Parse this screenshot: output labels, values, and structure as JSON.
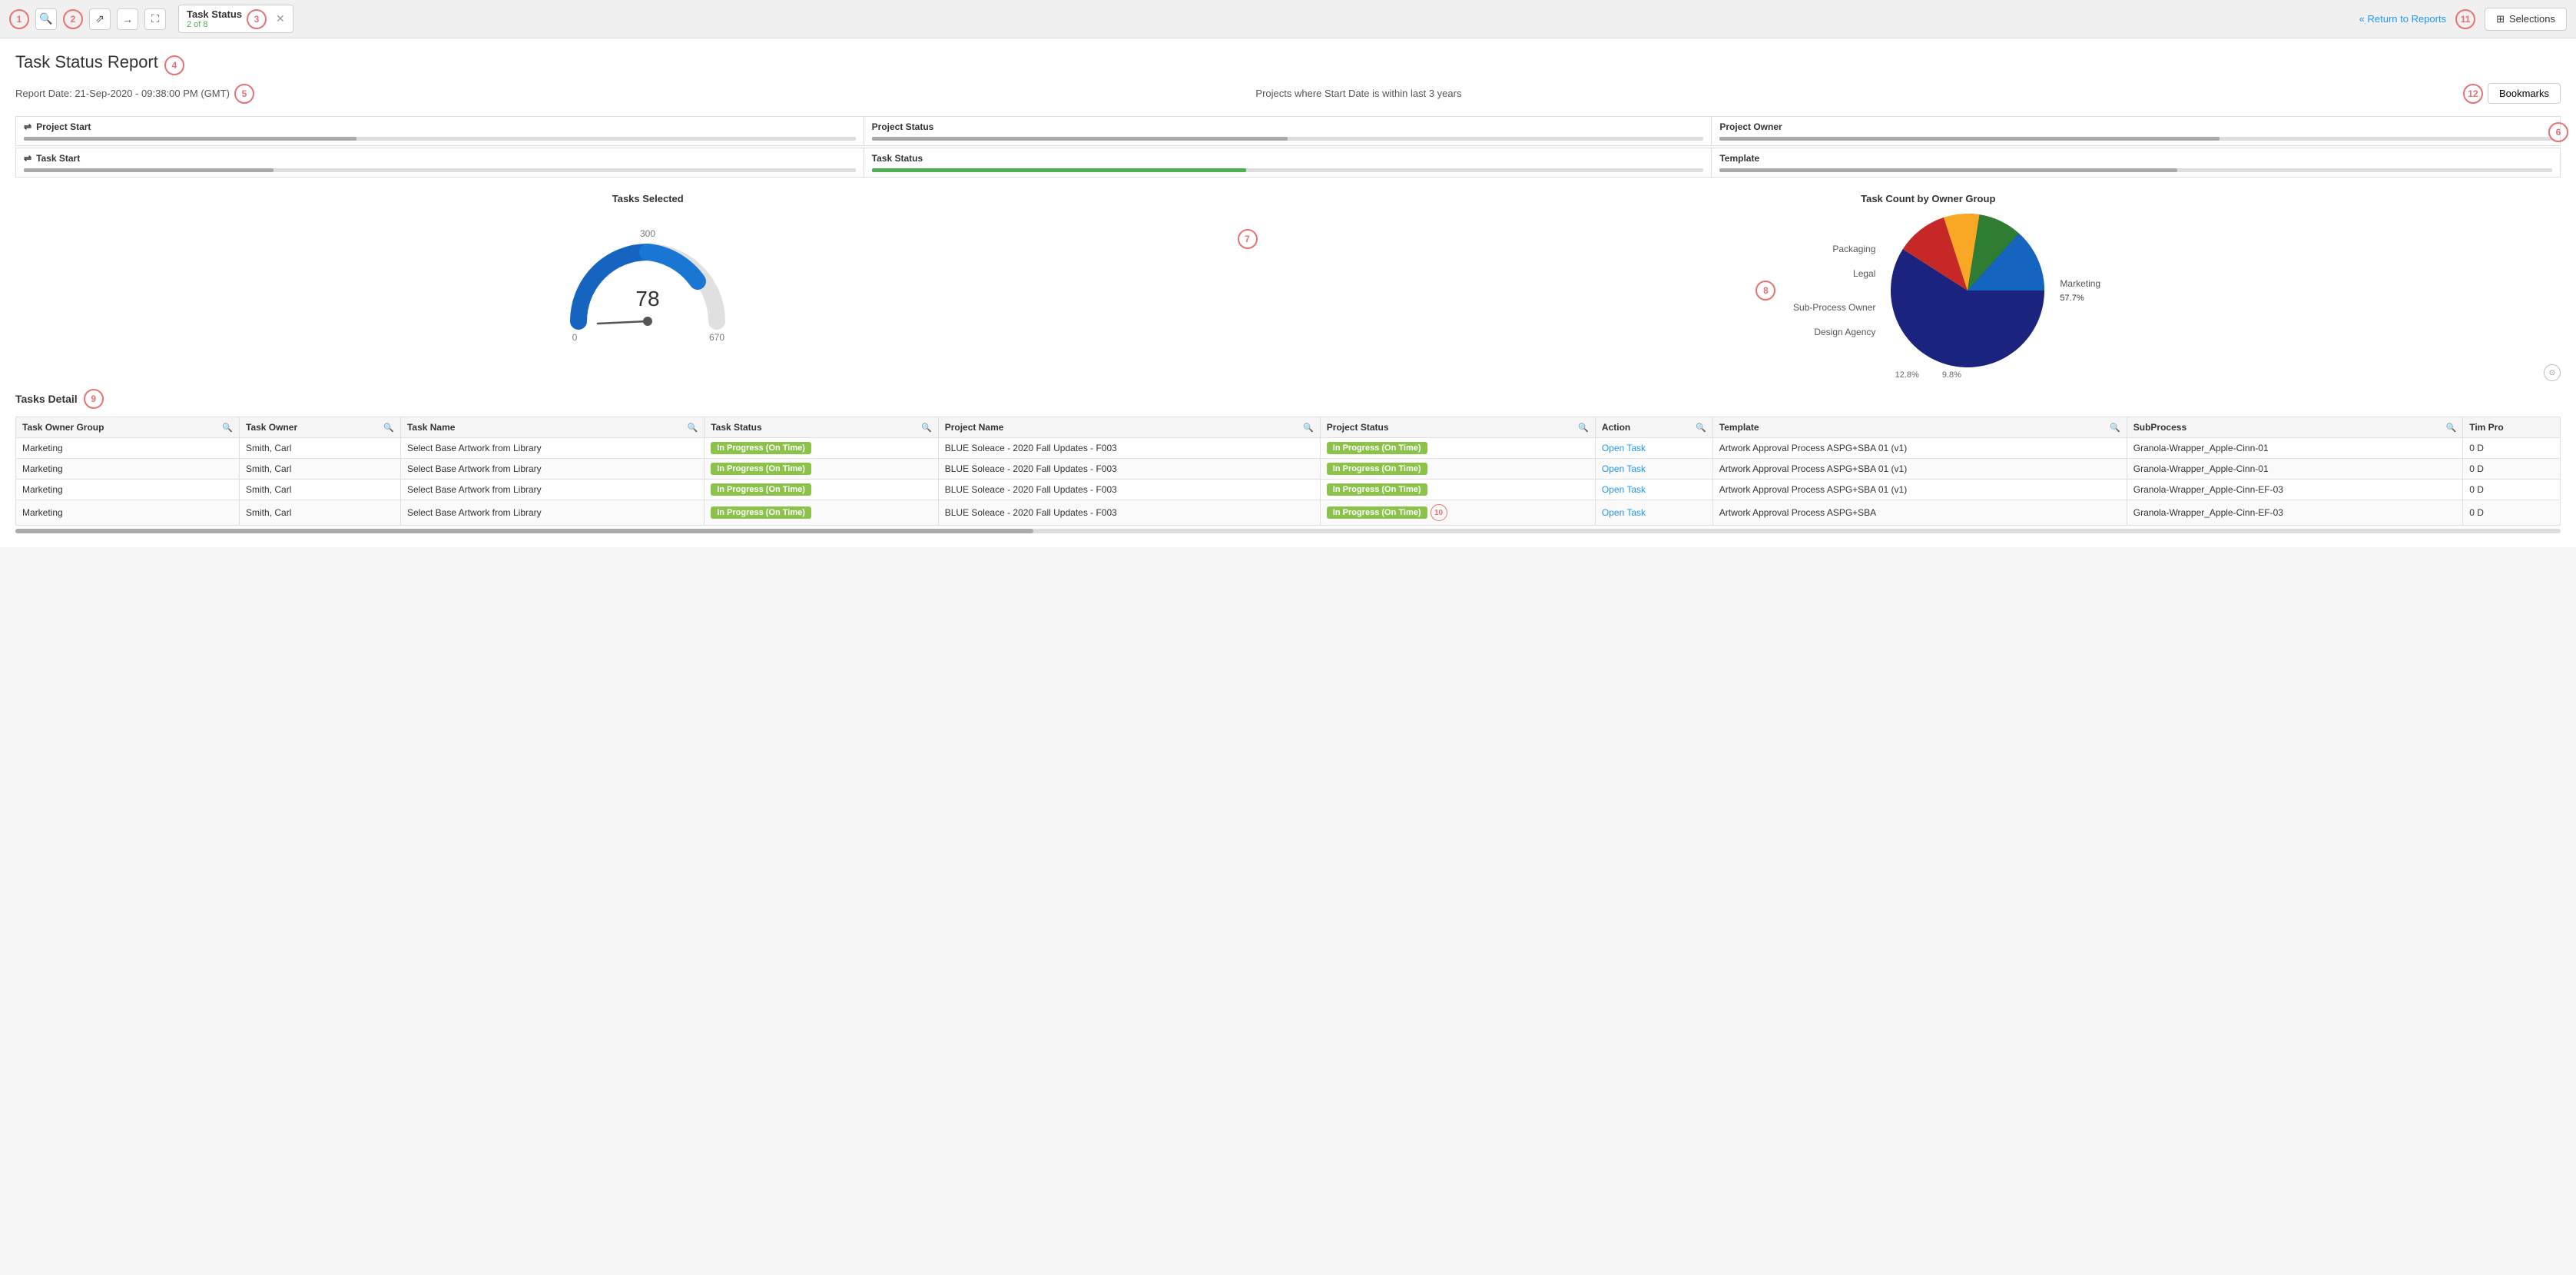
{
  "toolbar": {
    "tab_title": "Task Status",
    "tab_subtitle": "2 of 8",
    "return_link": "« Return to Reports",
    "selections_label": "Selections"
  },
  "report": {
    "title": "Task Status Report",
    "date": "Report Date: 21-Sep-2020 - 09:38:00 PM (GMT)",
    "filter_desc": "Projects where Start Date is within last 3 years",
    "bookmarks_label": "Bookmarks"
  },
  "filters": {
    "row1": [
      {
        "label": "Project Start",
        "bar_width": "40%",
        "bar_color": "gray"
      },
      {
        "label": "Project Status",
        "bar_width": "50%",
        "bar_color": "gray"
      },
      {
        "label": "Project Owner",
        "bar_width": "60%",
        "bar_color": "gray"
      }
    ],
    "row2": [
      {
        "label": "Task Start",
        "bar_width": "30%",
        "bar_color": "gray"
      },
      {
        "label": "Task Status",
        "bar_width": "45%",
        "bar_color": "green"
      },
      {
        "label": "Template",
        "bar_width": "55%",
        "bar_color": "gray"
      }
    ]
  },
  "gauge": {
    "title": "Tasks Selected",
    "value": "78",
    "min": "0",
    "max": "300",
    "right_label": "670"
  },
  "pie": {
    "title": "Task Count by Owner Group",
    "segments": [
      {
        "label": "Marketing",
        "value": 57.7,
        "color": "#1a237e",
        "text_color": "#fff"
      },
      {
        "label": "Design Agency",
        "value": 12.8,
        "color": "#1565c0",
        "text_color": "#fff",
        "pct": "12.8%"
      },
      {
        "label": "Sub-Process Owner",
        "value": 9.8,
        "color": "#2e7d32",
        "text_color": "#fff",
        "pct": "9.8%"
      },
      {
        "label": "Legal",
        "value": 8.0,
        "color": "#f9a825",
        "text_color": "#333"
      },
      {
        "label": "Packaging",
        "value": 11.7,
        "color": "#c62828",
        "text_color": "#fff"
      }
    ],
    "legend": [
      {
        "label": "Packaging",
        "color": "#c62828"
      },
      {
        "label": "Legal",
        "color": "#f9a825"
      },
      {
        "label": "Sub-Process Owner",
        "color": "#2e7d32"
      },
      {
        "label": "Design Agency",
        "color": "#1565c0"
      },
      {
        "label": "Marketing",
        "color": "#1a237e"
      }
    ]
  },
  "tasks_detail": {
    "title": "Tasks Detail",
    "columns": [
      "Task Owner Group",
      "Task Owner",
      "Task Name",
      "Task Status",
      "Project Name",
      "Project Status",
      "Action",
      "Template",
      "SubProcess",
      "Tim Pro"
    ],
    "rows": [
      {
        "task_owner_group": "Marketing",
        "task_owner": "Smith, Carl",
        "task_name": "Select Base Artwork from Library",
        "task_status": "In Progress (On Time)",
        "project_name": "BLUE Soleace - 2020 Fall Updates - F003",
        "project_status": "In Progress (On Time)",
        "action": "Open Task",
        "template": "Artwork Approval Process ASPG+SBA 01 (v1)",
        "subprocess": "Granola-Wrapper_Apple-Cinn-01",
        "time_pro": "0 D"
      },
      {
        "task_owner_group": "Marketing",
        "task_owner": "Smith, Carl",
        "task_name": "Select Base Artwork from Library",
        "task_status": "In Progress (On Time)",
        "project_name": "BLUE Soleace - 2020 Fall Updates - F003",
        "project_status": "In Progress (On Time)",
        "action": "Open Task",
        "template": "Artwork Approval Process ASPG+SBA 01 (v1)",
        "subprocess": "Granola-Wrapper_Apple-Cinn-01",
        "time_pro": "0 D"
      },
      {
        "task_owner_group": "Marketing",
        "task_owner": "Smith, Carl",
        "task_name": "Select Base Artwork from Library",
        "task_status": "In Progress (On Time)",
        "project_name": "BLUE Soleace - 2020 Fall Updates - F003",
        "project_status": "In Progress (On Time)",
        "action": "Open Task",
        "template": "Artwork Approval Process ASPG+SBA 01 (v1)",
        "subprocess": "Granola-Wrapper_Apple-Cinn-EF-03",
        "time_pro": "0 D"
      },
      {
        "task_owner_group": "Marketing",
        "task_owner": "Smith, Carl",
        "task_name": "Select Base Artwork from Library",
        "task_status": "In Progress (On Time)",
        "project_name": "BLUE Soleace - 2020 Fall Updates - F003",
        "project_status": "In Progress (On Time)",
        "action": "Open Task",
        "template": "Artwork Approval Process ASPG+SBA",
        "subprocess": "Granola-Wrapper_Apple-Cinn-EF-03",
        "time_pro": "0 D"
      }
    ]
  },
  "annotations": {
    "n1": "1",
    "n2": "2",
    "n3": "3",
    "n4": "4",
    "n5": "5",
    "n6": "6",
    "n7": "7",
    "n8": "8",
    "n9": "9",
    "n10": "10",
    "n11": "11",
    "n12": "12"
  }
}
